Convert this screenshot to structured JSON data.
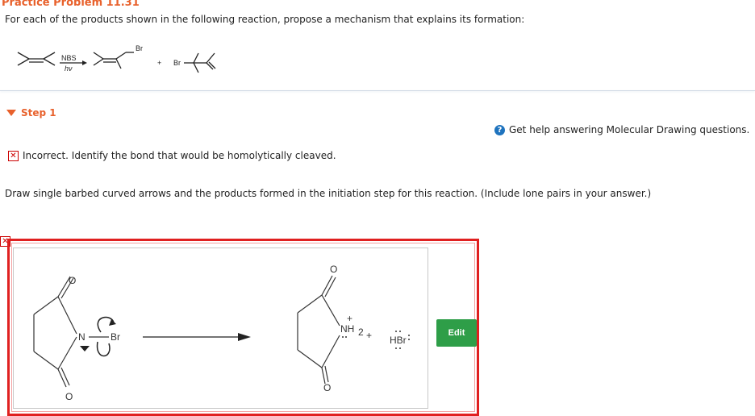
{
  "problem": {
    "title": "Practice Problem 11.31",
    "prompt": "For each of the products shown in the following reaction, propose a mechanism that explains its formation:"
  },
  "reaction": {
    "reagent_top": "NBS",
    "reagent_bottom": "hν",
    "plus": "+",
    "product_atom_1": "Br",
    "product_atom_2": "Br"
  },
  "step": {
    "label": "Step 1"
  },
  "help": {
    "text": "Get help answering Molecular Drawing questions.",
    "icon": "?"
  },
  "feedback": {
    "text": "Incorrect. Identify the bond that would be homolytically cleaved."
  },
  "instructions": "Draw single barbed curved arrows and the products formed in the initiation step for this reaction. (Include lone pairs in your answer.)",
  "drawing": {
    "atom_o": "O",
    "atom_n": "N",
    "atom_br": "Br",
    "atom_nh": "NH",
    "sub_2": "2",
    "charge_plus": "+",
    "plus": "+",
    "atom_hbr": "HBr"
  },
  "edit_button_label": "Edit",
  "colors": {
    "accent_orange": "#e8612c",
    "error_red": "#e02020",
    "edit_green": "#2e9e48",
    "help_blue": "#1e73be"
  }
}
